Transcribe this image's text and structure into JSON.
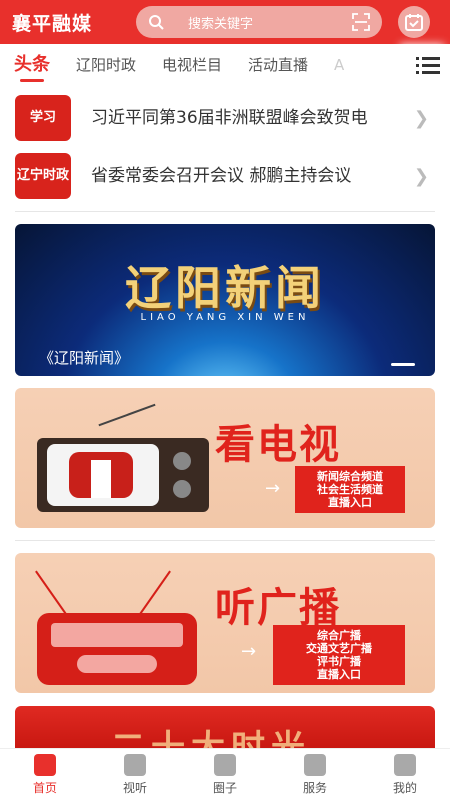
{
  "header": {
    "brand": "襄平融媒",
    "search_placeholder": "搜索关键字",
    "icons": [
      "search-icon",
      "scan-icon",
      "calendar-check-icon"
    ]
  },
  "tabs": [
    "头条",
    "辽阳时政",
    "电视栏目",
    "活动直播",
    "A"
  ],
  "active_tab": 0,
  "news": [
    {
      "logo": "学习",
      "title": "习近平同第36届非洲联盟峰会致贺电"
    },
    {
      "logo": "辽宁时政",
      "title": "省委常委会召开会议 郝鹏主持会议"
    }
  ],
  "banner_news": {
    "title": "辽阳新闻",
    "pinyin": "LIAO   YANG   XIN   WEN",
    "caption": "《辽阳新闻》"
  },
  "banner_tv": {
    "title": "看电视",
    "channels": [
      "新闻综合频道",
      "社会生活频道",
      "直播入口"
    ]
  },
  "banner_radio": {
    "title": "听广播",
    "channels": [
      "综合广播",
      "交通文艺广播",
      "评书广播",
      "直播入口"
    ]
  },
  "banner_partial": {
    "title": "二十大时光"
  },
  "bottom_nav": [
    {
      "label": "首页",
      "icon": "home-icon"
    },
    {
      "label": "视听",
      "icon": "video-icon"
    },
    {
      "label": "圈子",
      "icon": "star-icon"
    },
    {
      "label": "服务",
      "icon": "service-icon"
    },
    {
      "label": "我的",
      "icon": "user-icon"
    }
  ],
  "active_nav": 0,
  "colors": {
    "primary": "#e8302c"
  }
}
